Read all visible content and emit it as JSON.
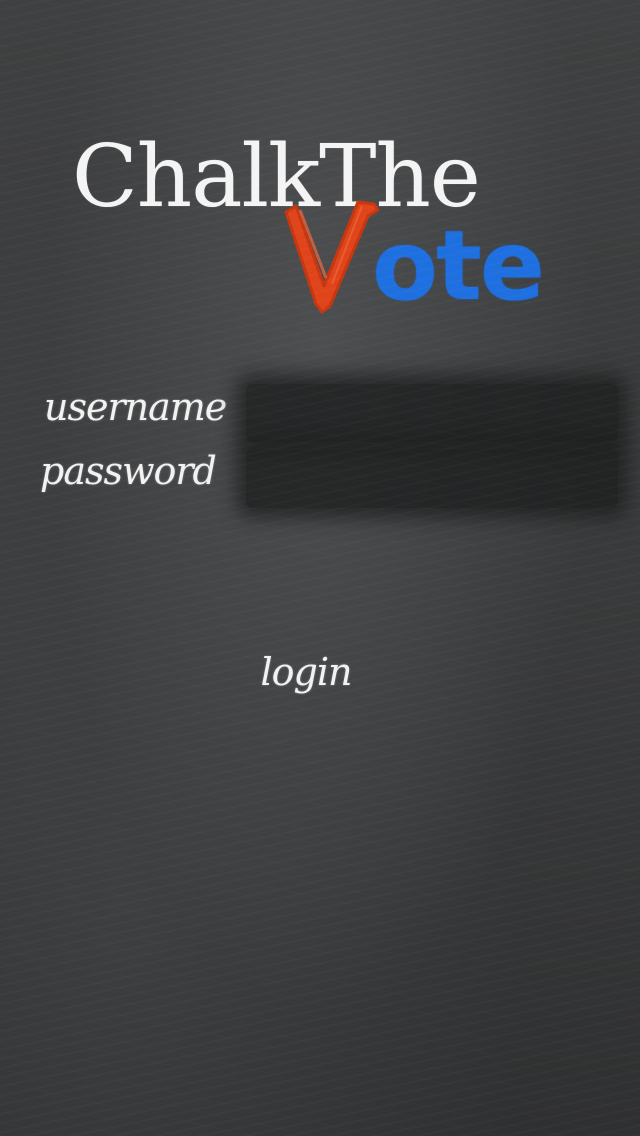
{
  "app": {
    "logo": {
      "main_text": "ChalkThe",
      "v_letter": "V",
      "rest_text": "ote",
      "colors": {
        "main": "#f4f4f4",
        "v": "#e0441a",
        "rest": "#1e6fe0"
      }
    }
  },
  "form": {
    "username_label": "username",
    "password_label": "password",
    "username_value": "",
    "password_value": "",
    "login_label": "login"
  },
  "theme": {
    "background": "#3a3b3c",
    "chalk_text": "#f2f2f2",
    "field_background": "#1c1d1e"
  }
}
